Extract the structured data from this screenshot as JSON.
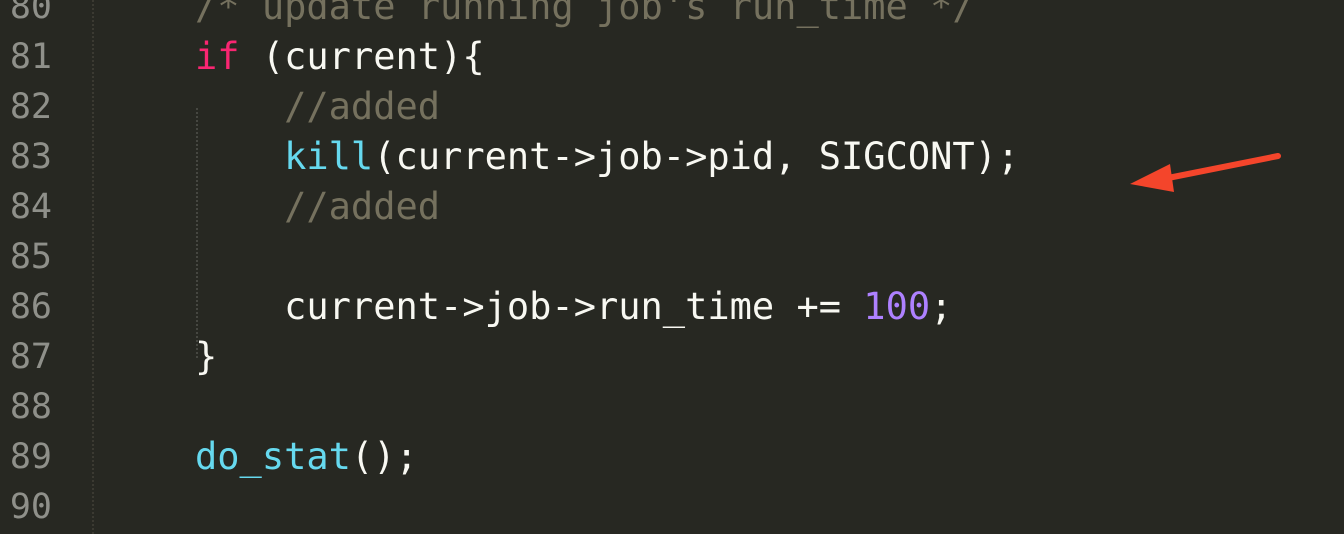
{
  "editor": {
    "line_numbers": [
      "80",
      "81",
      "82",
      "83",
      "84",
      "85",
      "86",
      "87",
      "88",
      "89",
      "90"
    ],
    "lines": [
      {
        "tokens": [
          {
            "type": "comment",
            "text": "/* update running job's run_time */"
          }
        ]
      },
      {
        "tokens": [
          {
            "type": "keyword",
            "text": "if"
          },
          {
            "type": "plain",
            "text": " (current){"
          }
        ]
      },
      {
        "tokens": [
          {
            "type": "indent",
            "text": "    "
          },
          {
            "type": "comment",
            "text": "//added"
          }
        ]
      },
      {
        "tokens": [
          {
            "type": "indent",
            "text": "    "
          },
          {
            "type": "function",
            "text": "kill"
          },
          {
            "type": "plain",
            "text": "(current->job->pid, SIGCONT);"
          }
        ]
      },
      {
        "tokens": [
          {
            "type": "indent",
            "text": "    "
          },
          {
            "type": "comment",
            "text": "//added"
          }
        ]
      },
      {
        "tokens": []
      },
      {
        "tokens": [
          {
            "type": "indent",
            "text": "    "
          },
          {
            "type": "plain",
            "text": "current->job->run_time += "
          },
          {
            "type": "number",
            "text": "100"
          },
          {
            "type": "plain",
            "text": ";"
          }
        ]
      },
      {
        "tokens": [
          {
            "type": "plain",
            "text": "}"
          }
        ]
      },
      {
        "tokens": []
      },
      {
        "tokens": [
          {
            "type": "function",
            "text": "do_stat"
          },
          {
            "type": "plain",
            "text": "();"
          }
        ]
      },
      {
        "tokens": []
      }
    ]
  },
  "annotation": {
    "arrow_color": "#f4452b",
    "target": "kill(current->job->pid, SIGCONT);",
    "icon": "red-arrow-icon"
  },
  "colors": {
    "background": "#272822",
    "comment": "#75715e",
    "keyword": "#f92672",
    "function": "#66d9ef",
    "number": "#ae81ff",
    "plain": "#f8f8f2",
    "line_number": "#8f908a"
  }
}
